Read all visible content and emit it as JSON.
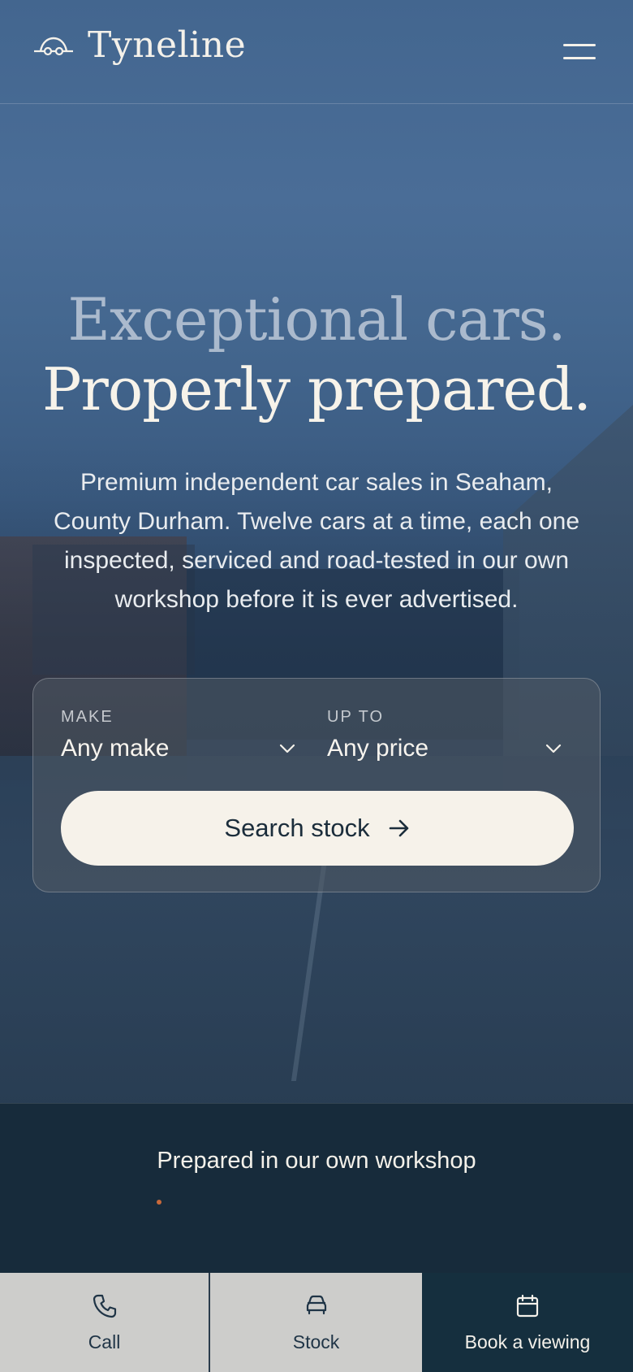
{
  "header": {
    "brand": "Tyneline",
    "logo_icon": "car-front-icon",
    "menu_icon": "hamburger-menu-icon"
  },
  "hero": {
    "headline_line1": "Exceptional cars.",
    "headline_line2": "Properly prepared.",
    "subtext": "Premium independent car sales in Seaham, County Durham. Twelve cars at a time, each one inspected, serviced and road-tested in our own workshop before it is ever advertised."
  },
  "search": {
    "make_label": "MAKE",
    "make_value": "Any make",
    "price_label": "UP TO",
    "price_value": "Any price",
    "button_label": "Search stock",
    "button_icon": "arrow-right-icon"
  },
  "band": {
    "title": "Prepared in our own workshop",
    "accent_color": "#c8693a"
  },
  "bottom_bar": {
    "call_label": "Call",
    "call_icon": "phone-icon",
    "stock_label": "Stock",
    "stock_icon": "car-icon",
    "book_label": "Book a viewing",
    "book_icon": "calendar-icon"
  },
  "colors": {
    "cream": "#f6f2ea",
    "navy": "#152f3e"
  }
}
